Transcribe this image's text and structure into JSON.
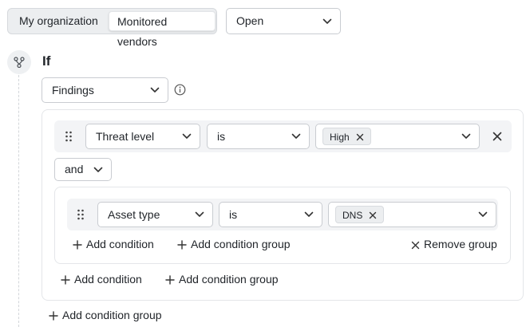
{
  "tabs": {
    "my_organization": "My organization",
    "monitored_vendors": "Monitored vendors",
    "active": "monitored_vendors"
  },
  "status_filter": {
    "value": "Open"
  },
  "rule": {
    "if_label": "If",
    "source": {
      "value": "Findings"
    },
    "conditions": [
      {
        "field": "Threat level",
        "operator": "is",
        "values": [
          "High"
        ]
      }
    ],
    "conjunction": "and",
    "nested_group": {
      "conditions": [
        {
          "field": "Asset type",
          "operator": "is",
          "values": [
            "DNS"
          ]
        }
      ],
      "add_condition": "Add condition",
      "add_condition_group": "Add condition group",
      "remove_group": "Remove group"
    },
    "add_condition": "Add condition",
    "add_condition_group": "Add condition group"
  },
  "root_add_condition_group": "Add condition group",
  "colors": {
    "accent_bg": "#f3f4f6",
    "border": "#c9ccd1",
    "text": "#1f2328"
  },
  "icons": [
    "branch-icon",
    "info-icon",
    "drag-handle-icon",
    "chevron-down-icon",
    "close-icon",
    "plus-icon"
  ]
}
